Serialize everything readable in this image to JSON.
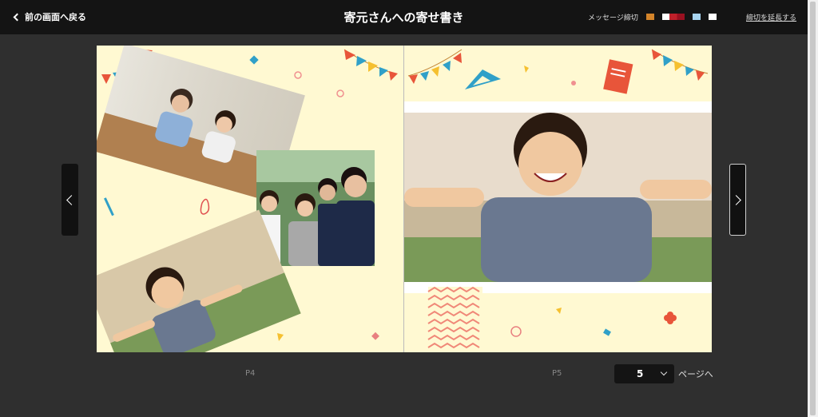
{
  "header": {
    "back_label": "前の画面へ戻る",
    "title": "寄元さんへの寄せ書き",
    "message_deadline_label": "メッセージ締切",
    "extend_label": "締切を延長する",
    "swatch_colors": [
      "#d4842a",
      "#ffffff",
      "#c0202a",
      "#9a1020",
      "#a8d4f0",
      "#ffffff"
    ]
  },
  "pages": {
    "left_label": "P4",
    "right_label": "P5"
  },
  "goto": {
    "value": "5",
    "suffix": "ページへ"
  },
  "icons": {
    "back": "chevron-left-icon",
    "prev": "chevron-left-icon",
    "next": "chevron-right-icon",
    "select": "chevron-down-icon"
  },
  "colors": {
    "page_bg": "#fff9d2",
    "topbar": "#141414",
    "background": "#2f2f2f"
  }
}
